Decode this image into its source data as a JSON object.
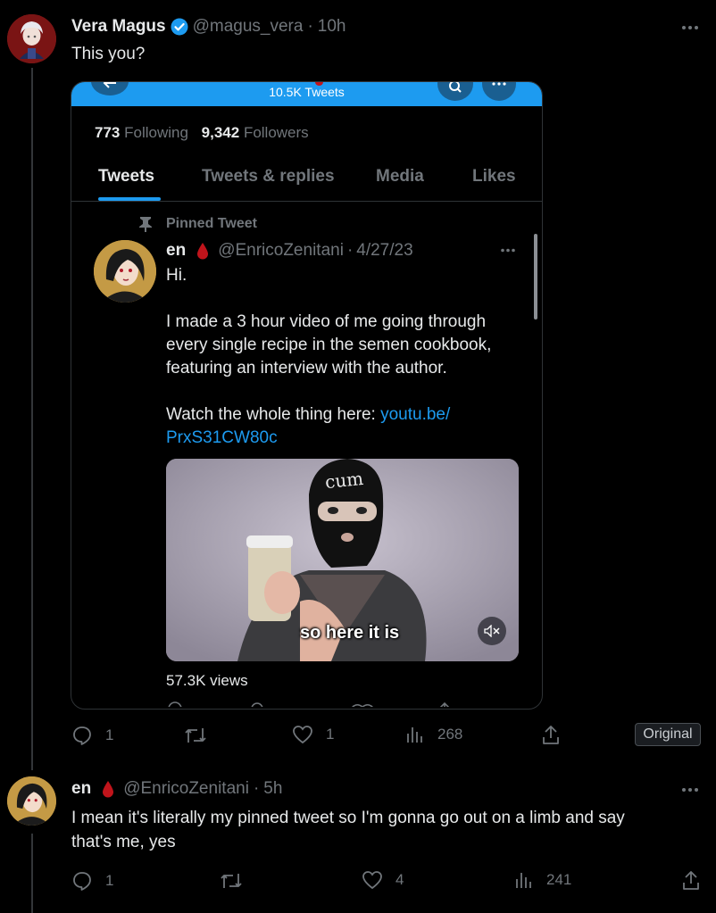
{
  "tweet1": {
    "author_name": "Vera Magus",
    "handle": "@magus_vera",
    "sep": "·",
    "time": "10h",
    "text": "This you?",
    "actions": {
      "replies": "1",
      "likes": "1",
      "views": "268"
    },
    "original_label": "Original"
  },
  "embed": {
    "header_count": "10.5K Tweets",
    "following_count": "773",
    "following_label": "Following",
    "followers_count": "9,342",
    "followers_label": "Followers",
    "tabs": [
      "Tweets",
      "Tweets & replies",
      "Media",
      "Likes"
    ],
    "pinned_label": "Pinned Tweet",
    "tweet": {
      "author_name": "en",
      "handle": "@EnricoZenitani",
      "sep": "·",
      "date": "4/27/23",
      "line1": "Hi.",
      "line2": "I made a 3 hour video of me going through",
      "line3": "every single recipe in the semen cookbook,",
      "line4": "featuring an interview with the author.",
      "line5": "Watch the whole thing here: ",
      "link1": "youtu.be/",
      "link2": "PrxS31CW80c",
      "video_caption": "so here it is",
      "mask_text": "cum",
      "views": "57.3K views"
    }
  },
  "tweet2": {
    "author_name": "en",
    "handle": "@EnricoZenitani",
    "sep": "·",
    "time": "5h",
    "line1": "I mean it's literally my pinned tweet so I'm gonna go out on a limb and say",
    "line2": "that's me, yes",
    "actions": {
      "replies": "1",
      "likes": "4",
      "views": "241"
    }
  },
  "colors": {
    "accent": "#1d9bf0",
    "background": "#000000",
    "border": "#2f3336",
    "blood": "#c0141b"
  }
}
